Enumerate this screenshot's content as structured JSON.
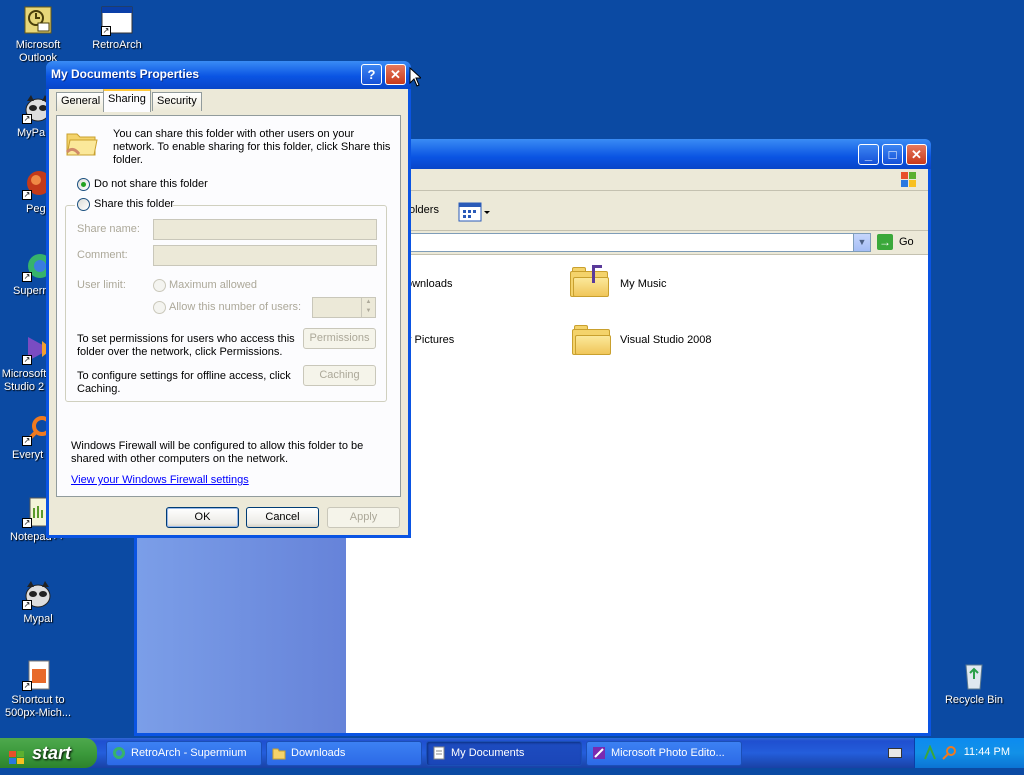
{
  "desktop": {
    "icons": [
      {
        "label": "Microsoft Outlook",
        "icon": "outlook-icon"
      },
      {
        "label": "RetroArch",
        "icon": "app-window-icon"
      },
      {
        "label": "MyPa",
        "icon": "raccoon-icon"
      },
      {
        "label": "Peg",
        "icon": "pegasus-icon"
      },
      {
        "label": "Superr",
        "icon": "globe-icon"
      },
      {
        "label": "Microsoft Studio 2",
        "icon": "visual-studio-icon"
      },
      {
        "label": "Everyt",
        "icon": "search-icon"
      },
      {
        "label": "Notepad++",
        "icon": "notepad-icon"
      },
      {
        "label": "Mypal",
        "icon": "raccoon-icon"
      },
      {
        "label": "Shortcut to 500px-Mich...",
        "icon": "image-file-icon"
      },
      {
        "label": "Recycle Bin",
        "icon": "recycle-bin-icon"
      }
    ]
  },
  "explorer": {
    "toolbar": {
      "folders_label": "olders"
    },
    "addressbar": {
      "go_label": "Go"
    },
    "items": [
      {
        "label": "ownloads"
      },
      {
        "label": "My Music"
      },
      {
        "label": "y Pictures"
      },
      {
        "label": "Visual Studio 2008"
      }
    ]
  },
  "dialog": {
    "title": "My Documents Properties",
    "tabs": [
      "General",
      "Sharing",
      "Security"
    ],
    "intro_line1": "You can share this folder with other users on your",
    "intro_line2": "network.  To enable sharing for this folder, click Share this",
    "intro_line3": "folder.",
    "radio_no_share": "Do not share this folder",
    "radio_share": "Share this folder",
    "share_name_label": "Share name:",
    "comment_label": "Comment:",
    "user_limit_label": "User limit:",
    "max_allowed": "Maximum allowed",
    "allow_number": "Allow this number of users:",
    "permissions_text1": "To set permissions for users who access this",
    "permissions_text2": "folder over the network, click Permissions.",
    "permissions_button": "Permissions",
    "caching_text1": "To configure settings for offline access, click",
    "caching_text2": "Caching.",
    "caching_button": "Caching",
    "firewall_text1": "Windows Firewall will be configured to allow this folder to be",
    "firewall_text2": "shared with other computers on the network.",
    "firewall_link": "View your Windows Firewall settings",
    "ok": "OK",
    "cancel": "Cancel",
    "apply": "Apply"
  },
  "taskbar": {
    "start": "start",
    "buttons": [
      {
        "label": "RetroArch - Supermium",
        "active": false
      },
      {
        "label": "Downloads",
        "active": false
      },
      {
        "label": "My Documents",
        "active": true
      },
      {
        "label": "Microsoft Photo Edito...",
        "active": false
      }
    ],
    "clock": "11:44 PM"
  }
}
